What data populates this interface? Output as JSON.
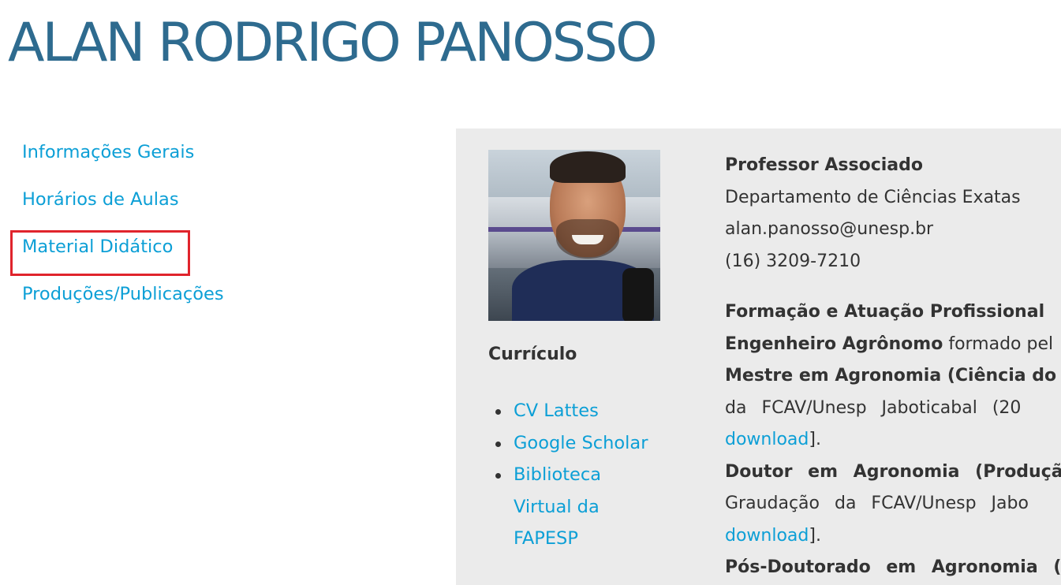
{
  "page": {
    "title": "ALAN RODRIGO PANOSSO"
  },
  "sidebar": {
    "items": [
      {
        "label": "Informações Gerais"
      },
      {
        "label": "Horários de Aulas"
      },
      {
        "label": "Material Didático"
      },
      {
        "label": "Produções/Publicações"
      }
    ]
  },
  "profile": {
    "photo_alt": "Foto de Alan Rodrigo Panosso",
    "role": "Professor Associado",
    "department": "Departamento de Ciências Exatas",
    "email": "alan.panosso@unesp.br",
    "phone": "(16) 3209-7210",
    "curriculo_title": "Currículo",
    "cv_links": [
      {
        "label": "CV Lattes"
      },
      {
        "label": "Google Scholar"
      },
      {
        "label": "Biblioteca Virtual da FAPESP"
      }
    ],
    "formacao_title": "Formação e Atuação Profissional",
    "formacao": {
      "line1_bold": "Engenheiro Agrônomo",
      "line1_rest": " formado pel",
      "line2_bold": "Mestre em Agronomia (Ciência do S",
      "line3": "da FCAV/Unesp Jaboticabal (20",
      "line4_link": "download",
      "line4_rest": "].",
      "line5_bold": "Doutor em Agronomia (Produçã",
      "line6": "Graudação da FCAV/Unesp Jabo",
      "line7_link": "download",
      "line7_rest": "].",
      "line8_bold": "Pós-Doutorado em Agronomia (C"
    }
  },
  "colors": {
    "title": "#2e6b8f",
    "link": "#0c9fd6",
    "panel_bg": "#ebebeb",
    "highlight_border": "#e0242c",
    "text": "#333333"
  }
}
